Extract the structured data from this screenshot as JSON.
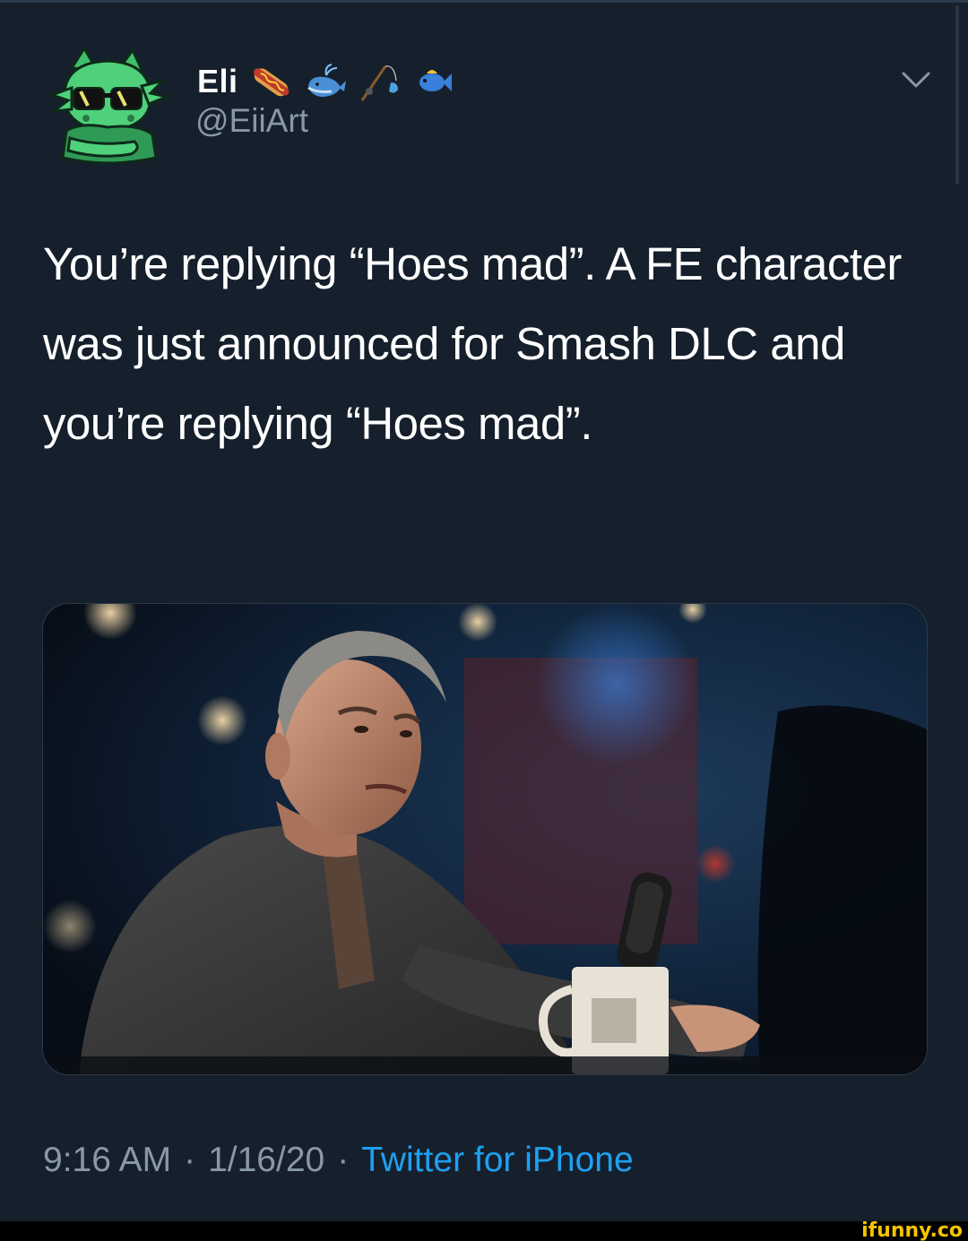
{
  "tweet": {
    "author": {
      "display_name": "Eli",
      "handle": "@EiiArt",
      "emojis": [
        "hotdog-emoji",
        "whale-emoji",
        "fishing-pole-emoji",
        "fish-emoji"
      ]
    },
    "text": "You’re replying “Hoes mad”. A FE character was just announced for Smash DLC and you’re replying “Hoes mad”.",
    "time": "9:16 AM",
    "date": "1/16/20",
    "separator": "·",
    "source": "Twitter for iPhone"
  },
  "watermark": "ifunny.co",
  "colors": {
    "background": "#16202c",
    "text": "#ffffff",
    "secondary": "#8899a6",
    "link": "#1da1f2",
    "watermark": "#f5c400"
  }
}
